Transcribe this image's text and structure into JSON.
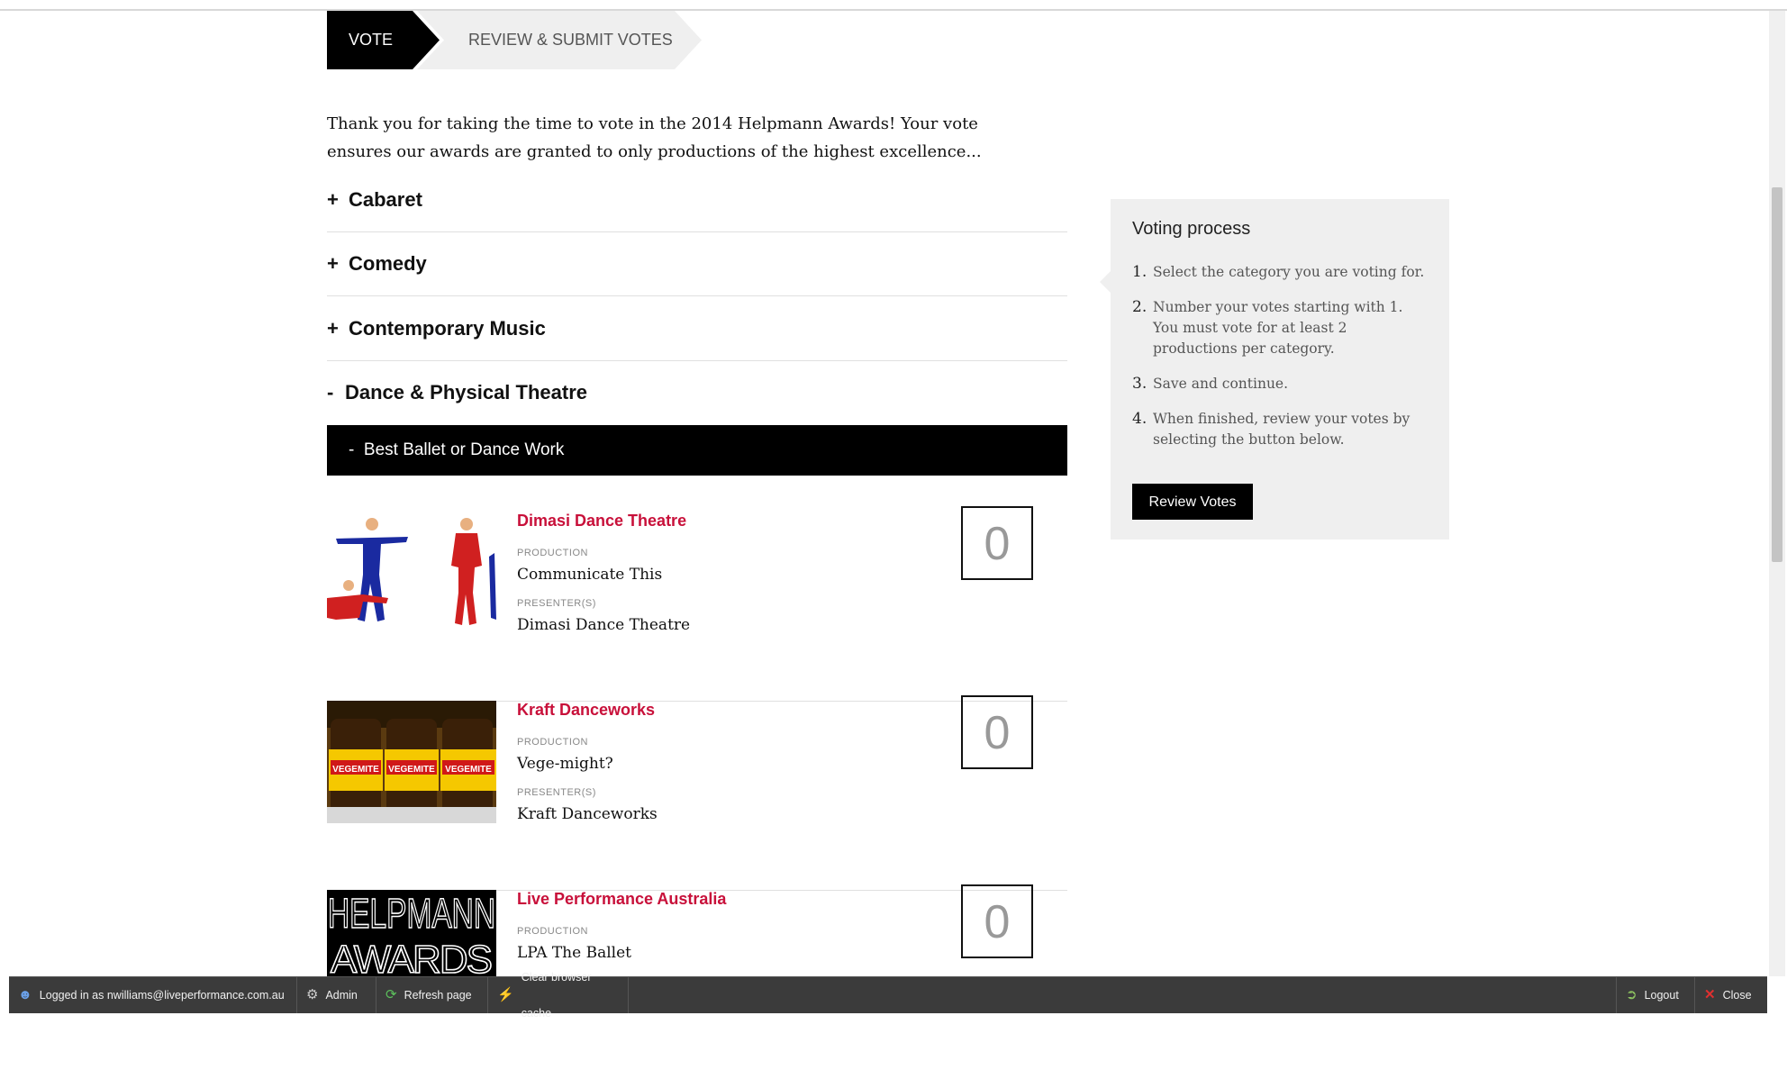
{
  "steps": {
    "vote": "VOTE",
    "review": "REVIEW & SUBMIT VOTES"
  },
  "intro": "Thank you for taking the time to vote in the 2014 Helpmann Awards! Your vote ensures our awards are granted to only productions of the highest excellence...",
  "categories": [
    {
      "sign": "+",
      "label": "Cabaret"
    },
    {
      "sign": "+",
      "label": "Comedy"
    },
    {
      "sign": "+",
      "label": "Contemporary Music"
    },
    {
      "sign": "-",
      "label": "Dance & Physical Theatre"
    }
  ],
  "subcategory": {
    "sign": "-",
    "label": "Best Ballet or Dance Work"
  },
  "labels": {
    "production": "PRODUCTION",
    "presenters": "PRESENTER(S)"
  },
  "nominees": [
    {
      "name": "Dimasi Dance Theatre",
      "production": "Communicate This",
      "presenter": "Dimasi Dance Theatre",
      "vote": "0"
    },
    {
      "name": "Kraft Danceworks",
      "production": "Vege-might?",
      "presenter": "Kraft Danceworks",
      "vote": "0",
      "jar_label": "VEGEMITE"
    },
    {
      "name": "Live Performance Australia",
      "production": "LPA The Ballet",
      "vote": "0",
      "logo_line1": "HELPMANN",
      "logo_line2": "AWARDS"
    }
  ],
  "sidebar": {
    "title": "Voting process",
    "steps": [
      {
        "num": "1.",
        "text": "Select the category you are voting for."
      },
      {
        "num": "2.",
        "text": "Number your votes starting with 1. You must vote for at least 2 productions per category."
      },
      {
        "num": "3.",
        "text": "Save and continue."
      },
      {
        "num": "4.",
        "text": "When finished, review your votes by selecting the button below."
      }
    ],
    "button": "Review Votes"
  },
  "toolbar": {
    "logged_in": "Logged in as nwilliams@liveperformance.com.au",
    "admin": "Admin",
    "refresh": "Refresh page",
    "cache": "Clear browser cache",
    "logout": "Logout",
    "close": "Close"
  }
}
